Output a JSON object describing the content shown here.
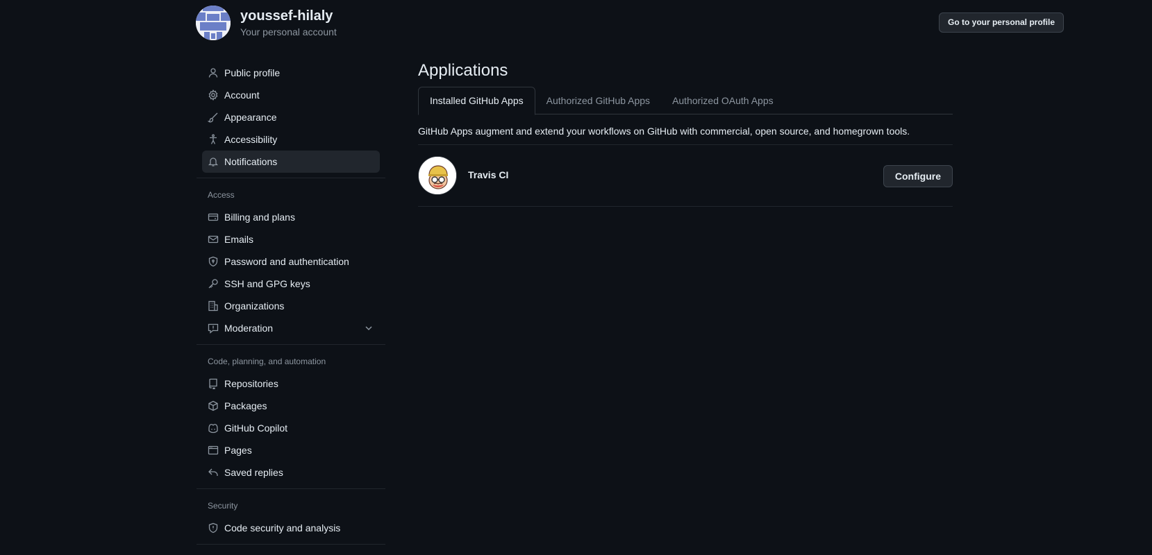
{
  "header": {
    "username": "youssef-hilaly",
    "account_type": "Your personal account",
    "profile_button": "Go to your personal profile"
  },
  "sidebar": {
    "top_items": [
      {
        "label": "Public profile",
        "icon": "person-icon"
      },
      {
        "label": "Account",
        "icon": "gear-icon"
      },
      {
        "label": "Appearance",
        "icon": "paintbrush-icon"
      },
      {
        "label": "Accessibility",
        "icon": "accessibility-icon"
      },
      {
        "label": "Notifications",
        "icon": "bell-icon",
        "active": true
      }
    ],
    "access": {
      "heading": "Access",
      "items": [
        {
          "label": "Billing and plans",
          "icon": "credit-card-icon"
        },
        {
          "label": "Emails",
          "icon": "mail-icon"
        },
        {
          "label": "Password and authentication",
          "icon": "shield-lock-icon"
        },
        {
          "label": "SSH and GPG keys",
          "icon": "key-icon"
        },
        {
          "label": "Organizations",
          "icon": "organization-icon"
        },
        {
          "label": "Moderation",
          "icon": "report-icon",
          "expandable": true
        }
      ]
    },
    "code": {
      "heading": "Code, planning, and automation",
      "items": [
        {
          "label": "Repositories",
          "icon": "repo-icon"
        },
        {
          "label": "Packages",
          "icon": "package-icon"
        },
        {
          "label": "GitHub Copilot",
          "icon": "copilot-icon"
        },
        {
          "label": "Pages",
          "icon": "browser-icon"
        },
        {
          "label": "Saved replies",
          "icon": "reply-icon"
        }
      ]
    },
    "security": {
      "heading": "Security",
      "items": [
        {
          "label": "Code security and analysis",
          "icon": "shield-icon"
        }
      ]
    }
  },
  "main": {
    "title": "Applications",
    "tabs": [
      {
        "label": "Installed GitHub Apps",
        "selected": true
      },
      {
        "label": "Authorized GitHub Apps"
      },
      {
        "label": "Authorized OAuth Apps"
      }
    ],
    "description": "GitHub Apps augment and extend your workflows on GitHub with commercial, open source, and homegrown tools.",
    "apps": [
      {
        "name": "Travis CI",
        "action": "Configure",
        "icon": "travis-ci-logo"
      }
    ]
  },
  "colors": {
    "background": "#0d1117",
    "text": "#e6edf3",
    "muted": "#8d96a0",
    "border": "#30363d",
    "button_bg": "#21262d"
  }
}
